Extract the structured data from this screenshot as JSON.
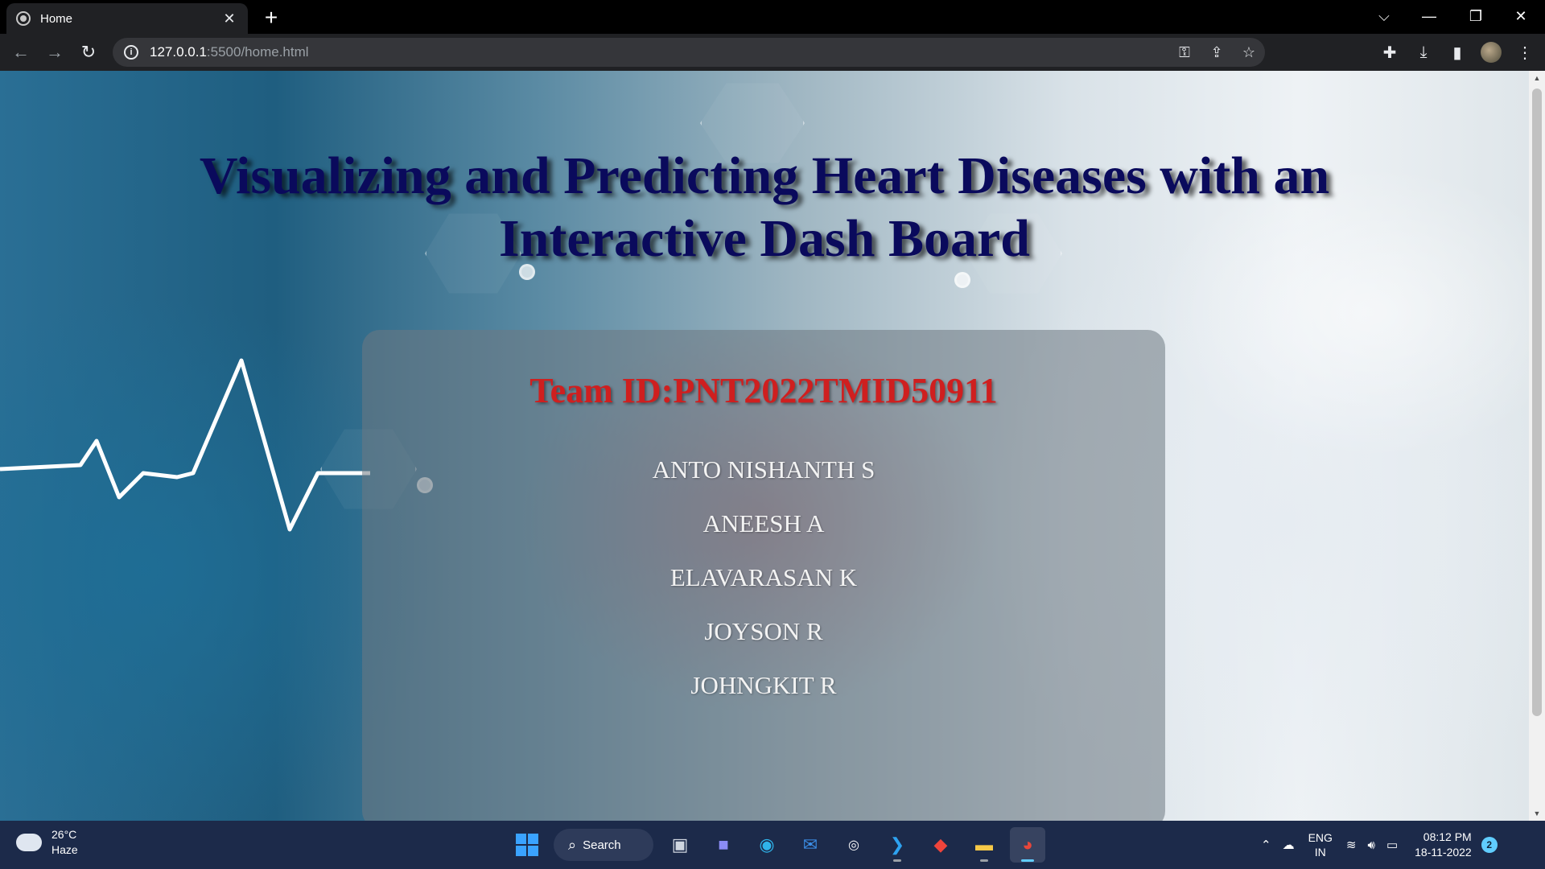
{
  "browser": {
    "tab_title": "Home",
    "url_host": "127.0.0.1",
    "url_path": ":5500/home.html"
  },
  "page": {
    "title": "Visualizing and Predicting Heart Diseases with an Interactive Dash Board",
    "team_id": "Team ID:PNT2022TMID50911",
    "members": [
      "ANTO NISHANTH S",
      "ANEESH A",
      "ELAVARASAN K",
      "JOYSON R",
      "JOHNGKIT R"
    ]
  },
  "taskbar": {
    "weather_temp": "26°C",
    "weather_desc": "Haze",
    "search_label": "Search",
    "lang_top": "ENG",
    "lang_bottom": "IN",
    "time": "08:12 PM",
    "date": "18-11-2022",
    "notification_count": "2"
  },
  "colors": {
    "title": "#0a0a5c",
    "team_id": "#cf1f1f",
    "members": "#f3f3f3"
  }
}
